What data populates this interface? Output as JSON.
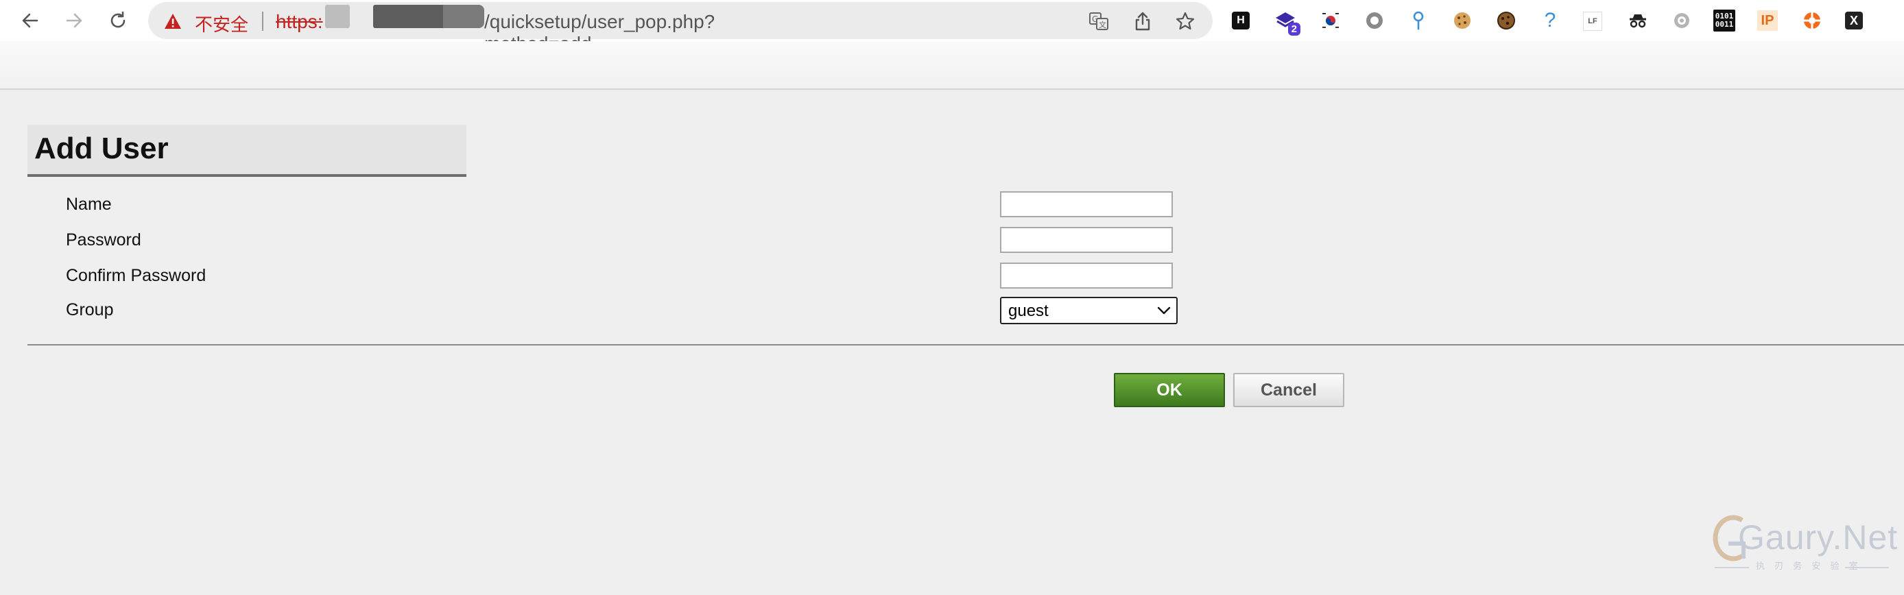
{
  "browser": {
    "security_label": "不安全",
    "url_scheme": "https:",
    "url_path": "/quicksetup/user_pop.php?method=add",
    "extensions": [
      {
        "name": "hackbar-extension-icon",
        "label": "H"
      },
      {
        "name": "layers-extension-icon",
        "badge": "2"
      },
      {
        "name": "korea-flag-extension-icon"
      },
      {
        "name": "circle-extension-icon"
      },
      {
        "name": "pin-extension-icon"
      },
      {
        "name": "cookie-extension-icon"
      },
      {
        "name": "cookie-editor-extension-icon"
      },
      {
        "name": "question-extension-icon",
        "label": "?"
      },
      {
        "name": "lf-extension-icon",
        "label": "LF"
      },
      {
        "name": "incognito-extension-icon"
      },
      {
        "name": "gear-extension-icon"
      },
      {
        "name": "binary-extension-icon",
        "label": "0101 0011"
      },
      {
        "name": "ip-extension-icon",
        "label": "IP"
      },
      {
        "name": "lifebuoy-extension-icon"
      },
      {
        "name": "x-extension-icon",
        "label": "X"
      }
    ]
  },
  "page": {
    "title": "Add User",
    "form": {
      "name_label": "Name",
      "name_value": "",
      "password_label": "Password",
      "password_value": "",
      "confirm_label": "Confirm Password",
      "confirm_value": "",
      "group_label": "Group",
      "group_value": "guest"
    },
    "buttons": {
      "ok": "OK",
      "cancel": "Cancel"
    }
  },
  "watermark": {
    "text": "Gaury.Net",
    "subtitle": "执 刃 务 安 验 室"
  },
  "colors": {
    "ok_button": "#4e8a2a",
    "insecure": "#c5221f",
    "page_bg": "#efefef"
  }
}
